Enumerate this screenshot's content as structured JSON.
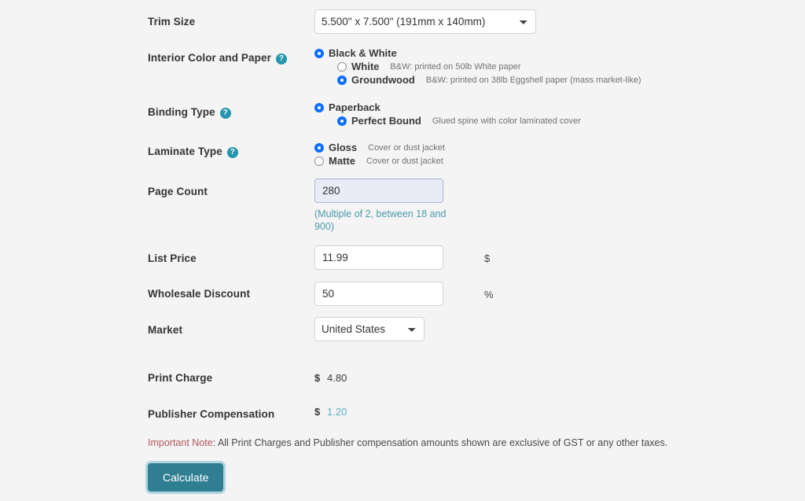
{
  "form": {
    "trim_size": {
      "label": "Trim Size",
      "value": "5.500\" x 7.500\" (191mm x 140mm)",
      "options": [
        "5.500\" x 7.500\" (191mm x 140mm)"
      ]
    },
    "interior": {
      "label": "Interior Color and Paper",
      "help_icon": "help-circle-icon",
      "primary": {
        "label": "Black & White",
        "selected": true
      },
      "sub_options": [
        {
          "label": "White",
          "desc": "B&W: printed on 50lb White paper",
          "selected": false
        },
        {
          "label": "Groundwood",
          "desc": "B&W: printed on 38lb Eggshell paper (mass market-like)",
          "selected": true
        }
      ]
    },
    "binding": {
      "label": "Binding Type",
      "help_icon": "help-circle-icon",
      "primary": {
        "label": "Paperback",
        "selected": true
      },
      "sub_options": [
        {
          "label": "Perfect Bound",
          "desc": "Glued spine with color laminated cover",
          "selected": true
        }
      ]
    },
    "laminate": {
      "label": "Laminate Type",
      "help_icon": "help-circle-icon",
      "options": [
        {
          "label": "Gloss",
          "desc": "Cover or dust jacket",
          "selected": true
        },
        {
          "label": "Matte",
          "desc": "Cover or dust jacket",
          "selected": false
        }
      ]
    },
    "page_count": {
      "label": "Page Count",
      "value": "280",
      "placeholder": "",
      "hint": "(Multiple of 2, between 18 and 900)"
    },
    "list_price": {
      "label": "List Price",
      "value": "11.99",
      "placeholder": "",
      "unit": "$"
    },
    "wholesale_discount": {
      "label": "Wholesale Discount",
      "value": "50",
      "placeholder": "",
      "unit": "%"
    },
    "market": {
      "label": "Market",
      "value": "United States",
      "options": [
        "United States"
      ]
    }
  },
  "results": {
    "print_charge": {
      "label": "Print Charge",
      "currency": "$",
      "value": "4.80"
    },
    "publisher_compensation": {
      "label": "Publisher Compensation",
      "currency": "$",
      "value": "1.20"
    }
  },
  "note": {
    "strong": "Important Note",
    "text": ": All Print Charges and Publisher compensation amounts shown are exclusive of GST or any other taxes."
  },
  "actions": {
    "calculate_label": "Calculate"
  },
  "colors": {
    "background": "#f4f4f4",
    "accent_button": "#2f7e92",
    "radio_selected": "#0d6efd",
    "help_icon": "#2596ad",
    "hint_text": "#4a9aad",
    "note_strong": "#b0565c",
    "value_teal": "#5fb0c4",
    "focused_input_bg": "#e9ebf5"
  }
}
